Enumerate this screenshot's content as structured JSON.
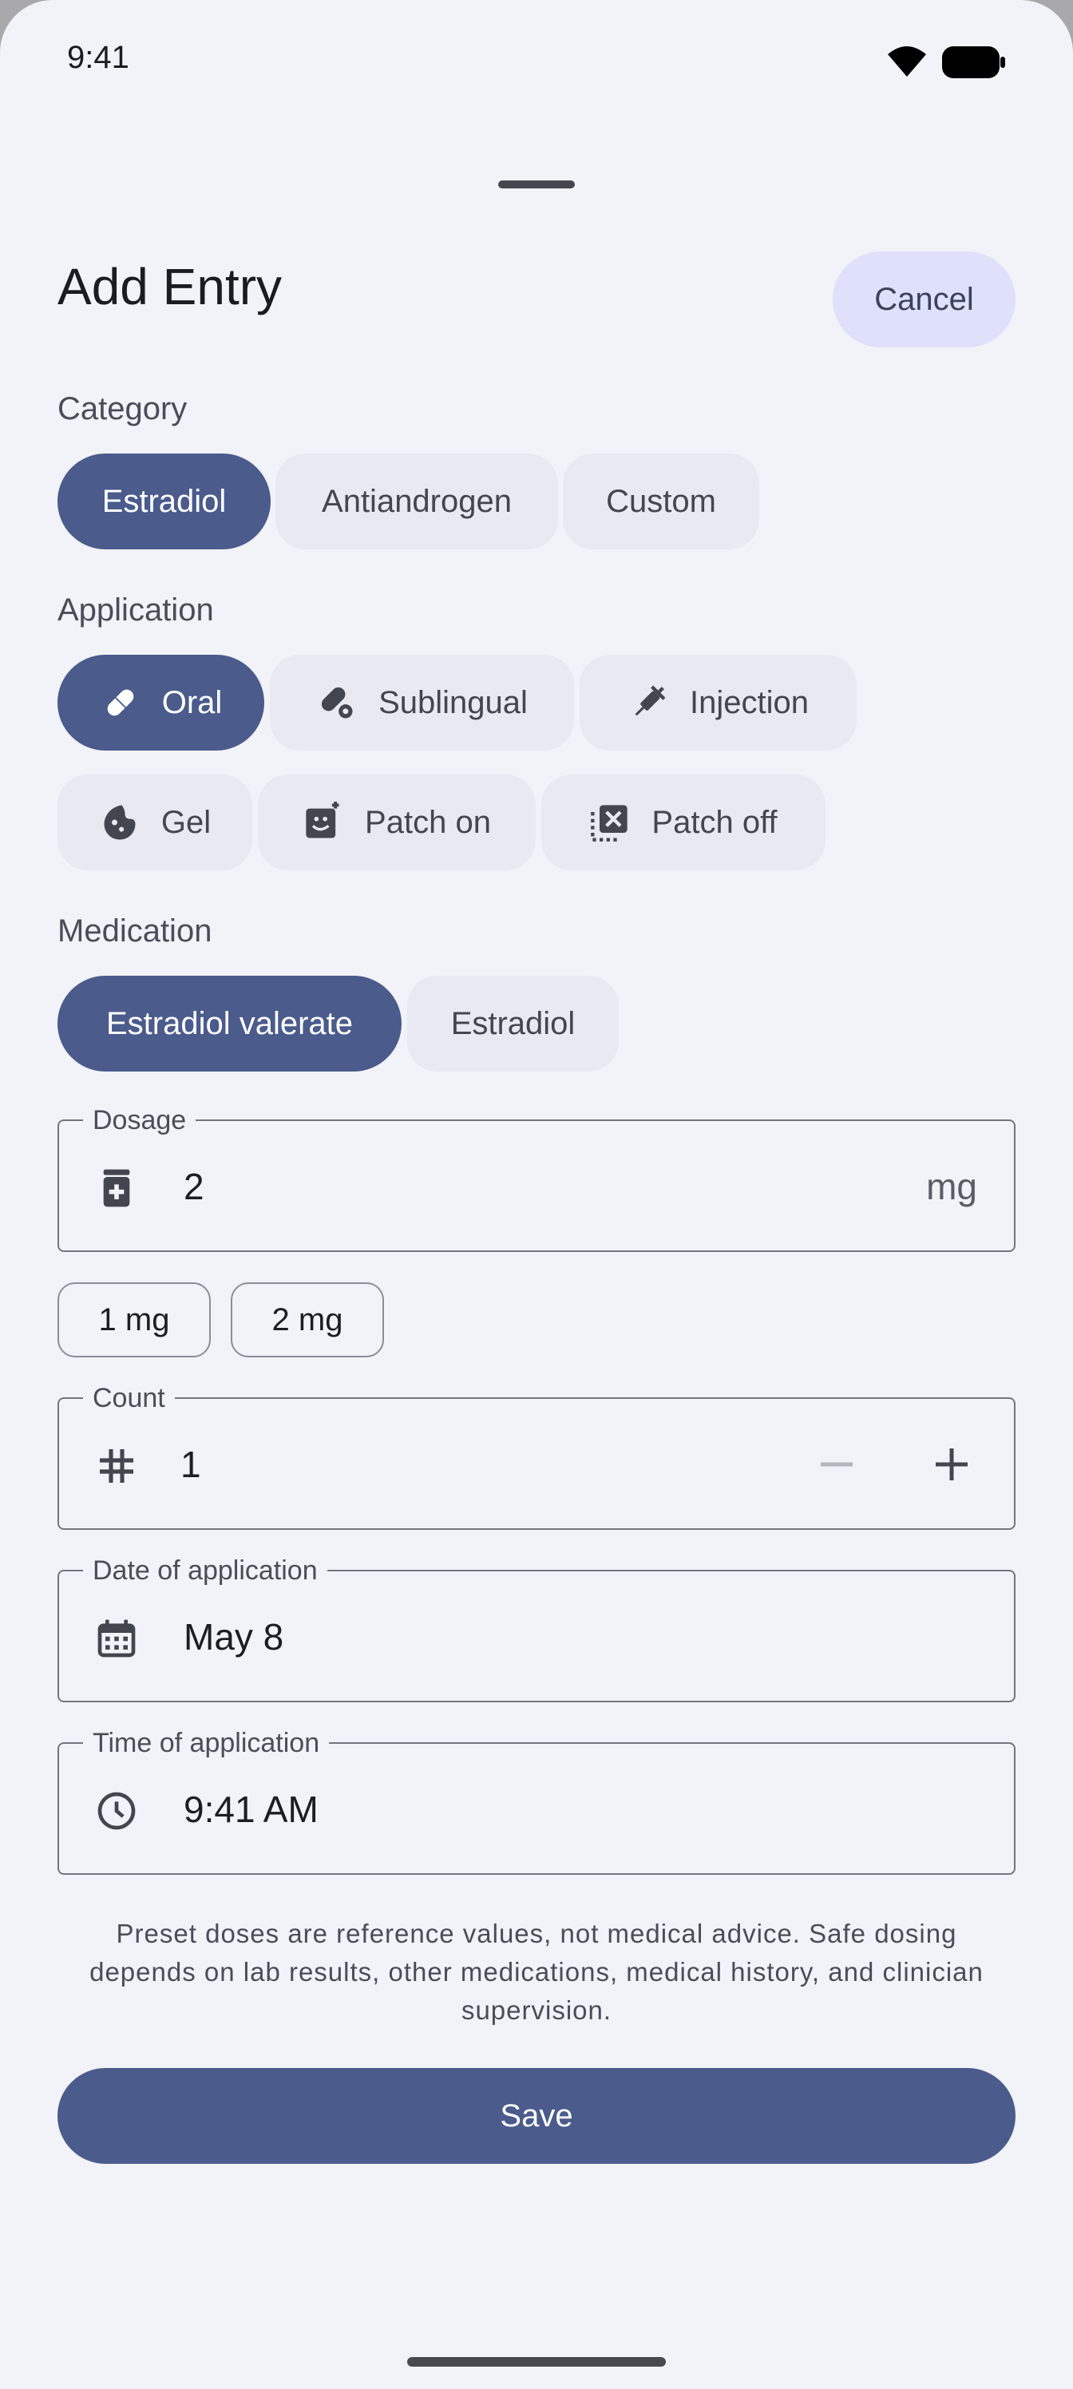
{
  "status_bar": {
    "time": "9:41"
  },
  "sheet": {
    "title": "Add Entry",
    "cancel_label": "Cancel"
  },
  "category": {
    "label": "Category",
    "options": [
      {
        "label": "Estradiol",
        "selected": true
      },
      {
        "label": "Antiandrogen",
        "selected": false
      },
      {
        "label": "Custom",
        "selected": false
      }
    ]
  },
  "application": {
    "label": "Application",
    "options": [
      {
        "label": "Oral",
        "icon": "pill-icon",
        "selected": true
      },
      {
        "label": "Sublingual",
        "icon": "sublingual-icon",
        "selected": false
      },
      {
        "label": "Injection",
        "icon": "syringe-icon",
        "selected": false
      },
      {
        "label": "Gel",
        "icon": "gel-icon",
        "selected": false
      },
      {
        "label": "Patch on",
        "icon": "patch-on-icon",
        "selected": false
      },
      {
        "label": "Patch off",
        "icon": "patch-off-icon",
        "selected": false
      }
    ]
  },
  "medication": {
    "label": "Medication",
    "options": [
      {
        "label": "Estradiol valerate",
        "selected": true
      },
      {
        "label": "Estradiol",
        "selected": false
      }
    ]
  },
  "dosage": {
    "label": "Dosage",
    "value": "2",
    "unit": "mg",
    "icon": "medication-icon"
  },
  "presets": [
    "1 mg",
    "2 mg"
  ],
  "count": {
    "label": "Count",
    "value": "1",
    "icon": "hash-icon"
  },
  "date": {
    "label": "Date of application",
    "value": "May 8",
    "icon": "calendar-icon"
  },
  "time": {
    "label": "Time of application",
    "value": "9:41 AM",
    "icon": "clock-icon"
  },
  "disclaimer": "Preset doses are reference values, not medical advice. Safe dosing depends on lab results, other medications, medical history, and clinician supervision.",
  "save_label": "Save",
  "colors": {
    "primary": "#4a5b8c",
    "chip_unselected": "#e8e9f1",
    "cancel_bg": "#dee1f9",
    "background": "#f2f3f9"
  }
}
